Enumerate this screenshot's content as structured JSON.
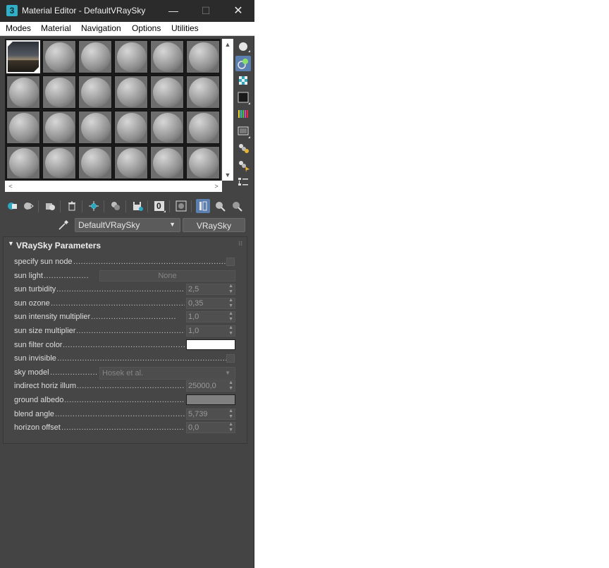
{
  "window": {
    "app_icon": "3",
    "title": "Material Editor - DefaultVRaySky",
    "controls": {
      "minimize": "—",
      "maximize": "☐",
      "close": "✕"
    }
  },
  "menu": [
    "Modes",
    "Material",
    "Navigation",
    "Options",
    "Utilities"
  ],
  "sample_slots": {
    "columns": 6,
    "rows": 4,
    "active_index": 0
  },
  "scroll_arrows": {
    "up": "▲",
    "down": "▼",
    "left": "<",
    "right": ">"
  },
  "side_tools": [
    {
      "name": "sample-type-sphere-icon",
      "active": false
    },
    {
      "name": "backlight-icon",
      "active": true
    },
    {
      "name": "background-checker-icon",
      "active": false
    },
    {
      "name": "sample-uv-tiling-icon",
      "active": false
    },
    {
      "name": "video-color-check-icon",
      "active": false
    },
    {
      "name": "make-preview-icon",
      "active": false
    },
    {
      "name": "material-options-icon",
      "active": false
    },
    {
      "name": "select-by-material-icon",
      "active": false
    },
    {
      "name": "material-map-navigator-icon",
      "active": false
    }
  ],
  "bottom_tools": [
    {
      "name": "get-material-icon",
      "active": false
    },
    {
      "name": "put-to-scene-icon",
      "active": false
    },
    {
      "name": "assign-to-selection-icon",
      "active": false
    },
    {
      "name": "reset-map-icon",
      "active": false
    },
    {
      "name": "make-unique-icon",
      "active": false
    },
    {
      "name": "put-to-library-icon",
      "active": false
    },
    {
      "name": "save-to-library-icon",
      "active": false
    },
    {
      "name": "material-id-channel-icon",
      "label": "0",
      "active": false
    },
    {
      "name": "show-shaded-in-viewport-icon",
      "active": false
    },
    {
      "name": "show-end-result-icon",
      "active": true
    },
    {
      "name": "go-to-parent-icon",
      "active": false
    },
    {
      "name": "go-forward-to-sibling-icon",
      "active": false
    }
  ],
  "material": {
    "name": "DefaultVRaySky",
    "type": "VRaySky",
    "dropdown_arrow": "▼"
  },
  "rollout": {
    "title": "VRaySky Parameters",
    "toggle": "▼",
    "grip": "⁝⁝",
    "params": [
      {
        "label": "specify sun node",
        "dots": "..........................................................................",
        "control": "checkbox"
      },
      {
        "label": "sun light",
        "dots": "..................",
        "control": "button",
        "value": "None"
      },
      {
        "label": "sun turbidity",
        "dots": "...............................................................",
        "control": "spinner",
        "value": "2,5"
      },
      {
        "label": "sun ozone",
        "dots": ".....................................................................",
        "control": "spinner",
        "value": "0,35"
      },
      {
        "label": "sun intensity multiplier",
        "dots": "..................................",
        "control": "spinner",
        "value": "1,0"
      },
      {
        "label": "sun size multiplier",
        "dots": "......................................................",
        "control": "spinner",
        "value": "1,0"
      },
      {
        "label": "sun filter color",
        "dots": ".............................................................",
        "control": "swatch",
        "color": "#ffffff"
      },
      {
        "label": "sun invisible",
        "dots": ".........................................................................................",
        "control": "checkbox"
      },
      {
        "label": "sky model",
        "dots": "...................",
        "control": "dropdown",
        "value": "Hosek et al."
      },
      {
        "label": "indirect horiz illum",
        "dots": "....................................................",
        "control": "spinner",
        "value": "25000,0"
      },
      {
        "label": "ground albedo",
        "dots": "..............................................................",
        "control": "swatch",
        "color": "#808080"
      },
      {
        "label": "blend angle",
        "dots": "..................................................................",
        "control": "spinner",
        "value": "5,739"
      },
      {
        "label": "horizon offset",
        "dots": ".............................................................",
        "control": "spinner",
        "value": "0,0"
      }
    ]
  },
  "colors": {
    "panel_bg": "#444444",
    "titlebar_bg": "#2b2b2b",
    "accent": "#5b80b0"
  }
}
